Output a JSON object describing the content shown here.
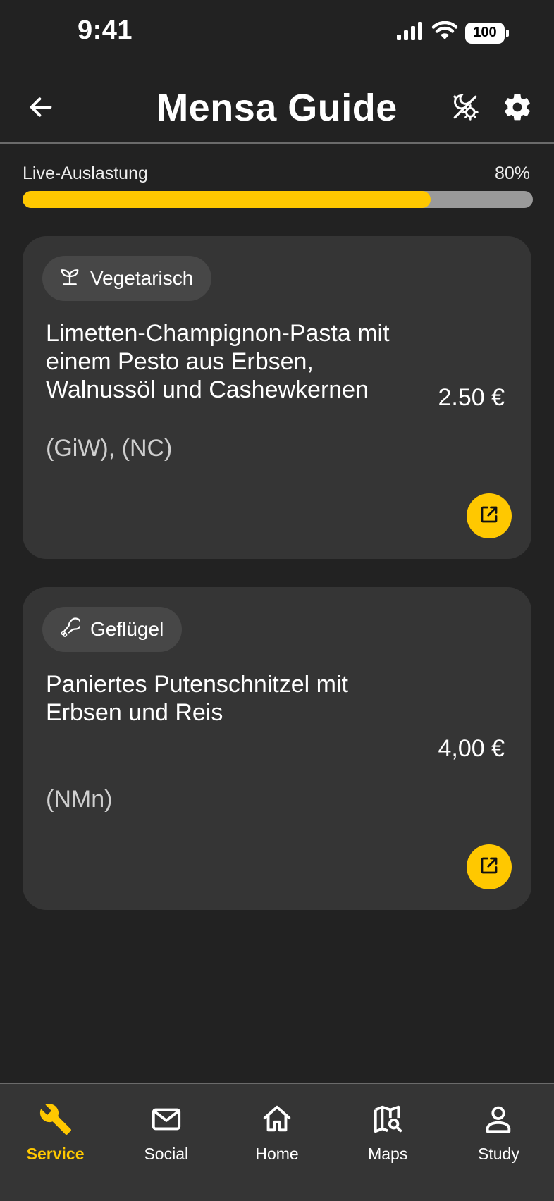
{
  "status_bar": {
    "time": "9:41",
    "battery": "100"
  },
  "header": {
    "title": "Mensa Guide"
  },
  "load": {
    "label": "Live-Auslastung",
    "percent_text": "80%",
    "fraction": 0.8
  },
  "meals": [
    {
      "category": "Vegetarisch",
      "category_icon": "sprout-icon",
      "name": "Limetten-Champignon-Pasta mit einem Pesto aus Erbsen, Walnussöl und Cashewkernen",
      "price": "2.50 €",
      "codes": "(GiW), (NC)"
    },
    {
      "category": "Geflügel",
      "category_icon": "drumstick-icon",
      "name": "Paniertes Putenschnitzel mit Erbsen und Reis",
      "price": "4,00 €",
      "codes": "(NMn)"
    }
  ],
  "nav": {
    "active": "service",
    "items": [
      {
        "label": "Service",
        "icon": "wrench-icon"
      },
      {
        "label": "Social",
        "icon": "mail-icon"
      },
      {
        "label": "Home",
        "icon": "home-icon"
      },
      {
        "label": "Maps",
        "icon": "map-search-icon"
      },
      {
        "label": "Study",
        "icon": "person-icon"
      }
    ]
  },
  "colors": {
    "accent": "#ffc800",
    "background": "#222222",
    "card": "#353535",
    "chip": "#474747"
  }
}
